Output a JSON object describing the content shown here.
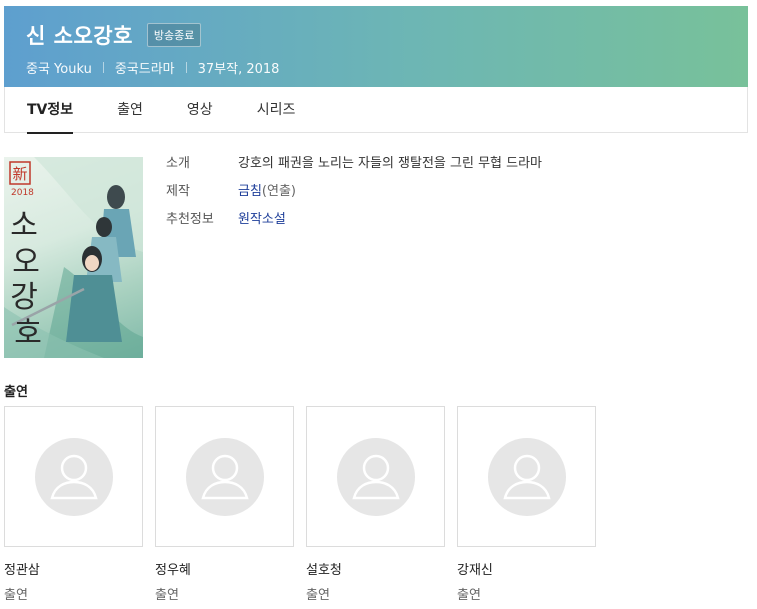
{
  "header": {
    "title": "신 소오강호",
    "badge": "방송종료",
    "meta": [
      "중국 Youku",
      "중국드라마",
      "37부작, 2018"
    ]
  },
  "tabs": [
    {
      "label": "TV정보",
      "active": true
    },
    {
      "label": "출연",
      "active": false
    },
    {
      "label": "영상",
      "active": false
    },
    {
      "label": "시리즈",
      "active": false
    }
  ],
  "poster": {
    "seal": "新",
    "year": "2018",
    "title_chars": [
      "소",
      "오",
      "강",
      "호"
    ]
  },
  "info": {
    "intro_label": "소개",
    "intro_value": "강호의 패권을 노리는 자들의 쟁탈전을 그린 무협 드라마",
    "production_label": "제작",
    "production_link": "금침",
    "production_role": "(연출)",
    "recommend_label": "추천정보",
    "recommend_link": "원작소설"
  },
  "cast": {
    "title": "출연",
    "members": [
      {
        "name": "정관삼",
        "role": "출연"
      },
      {
        "name": "정우혜",
        "role": "출연"
      },
      {
        "name": "설호청",
        "role": "출연"
      },
      {
        "name": "강재신",
        "role": "출연"
      }
    ]
  },
  "colors": {
    "header_gradient_start": "#5e9fcf",
    "header_gradient_end": "#78c19a",
    "link": "#1f3f9a"
  }
}
